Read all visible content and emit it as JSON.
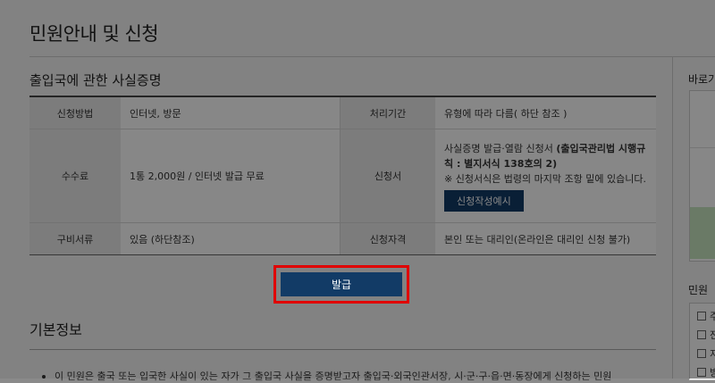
{
  "page": {
    "title": "민원안내 및 신청",
    "section_title": "출입국에 관한 사실증명"
  },
  "table": {
    "rows": [
      {
        "h1": "신청방법",
        "v1": "인터넷, 방문",
        "h2": "처리기간",
        "v2": "유형에 따라 다름( 하단 참조 )"
      },
      {
        "h1": "수수료",
        "v1": "1통 2,000원 / 인터넷 발급 무료",
        "h2": "신청서",
        "v2_line1": "사실증명 발급·열람 신청서 ",
        "v2_bold": "(출입국관리법 시행규칙 : 별지서식 138호의 2)",
        "v2_note": "※ 신청서식은 법령의 마지막 조항 밑에 있습니다.",
        "sample_button": "신청작성예시"
      },
      {
        "h1": "구비서류",
        "v1": "있음 (하단참조)",
        "h2": "신청자격",
        "v2": "본인 또는 대리인(온라인은 대리인 신청 불가)"
      }
    ]
  },
  "issue_button": "발급",
  "basic_info": {
    "title": "기본정보",
    "bullet": "이 민원은 출국 또는 입국한 사실이 있는 자가 그 출입국 사실을 증명받고자 출입국·외국인관서장, 시·군·구·읍·면·동장에게 신청하는 민원"
  },
  "sidebar": {
    "quick_label": "바로가",
    "minwon_label": "민원 ",
    "list_items": [
      "주",
      "전",
      "지",
      "방"
    ]
  },
  "colors": {
    "accent": "#123b66",
    "highlight": "#e00000"
  }
}
